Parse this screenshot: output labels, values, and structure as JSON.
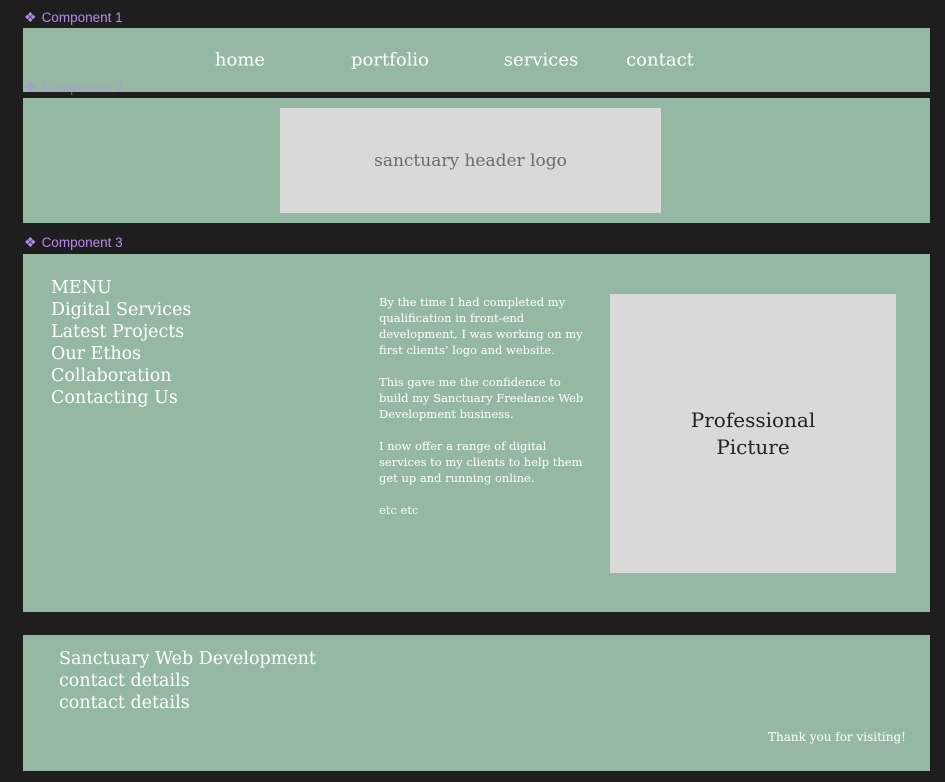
{
  "components": {
    "c1": "Component 1",
    "c2": "Component 2",
    "c3": "Component 3",
    "icon": "component-icon"
  },
  "nav": {
    "items": [
      {
        "label": "home"
      },
      {
        "label": "portfolio"
      },
      {
        "label": "services"
      },
      {
        "label": "contact"
      }
    ]
  },
  "header": {
    "logo": "sanctuary header logo"
  },
  "content": {
    "menu": {
      "title": "MENU",
      "items": [
        {
          "label": "Digital Services"
        },
        {
          "label": "Latest Projects"
        },
        {
          "label": "Our Ethos"
        },
        {
          "label": "Collaboration"
        },
        {
          "label": "Contacting Us"
        }
      ]
    },
    "bio": [
      "By the time I had completed my qualification in front-end development, I was working on my first clients’ logo and website.",
      "This gave me the confidence to build my Sanctuary Freelance Web Development business.",
      "I now offer a range of digital services to my clients to help them get up and running online.",
      "etc etc"
    ],
    "picture": "Professional Picture"
  },
  "footer": {
    "lines": [
      "Sanctuary Web Development",
      "contact details",
      "contact details"
    ],
    "thanks": "Thank you for visiting!"
  },
  "colors": {
    "canvas": "#1e1e1e",
    "frame": "#94b8a2",
    "placeholder": "#d9d9d9",
    "component_label": "#b88af0"
  }
}
